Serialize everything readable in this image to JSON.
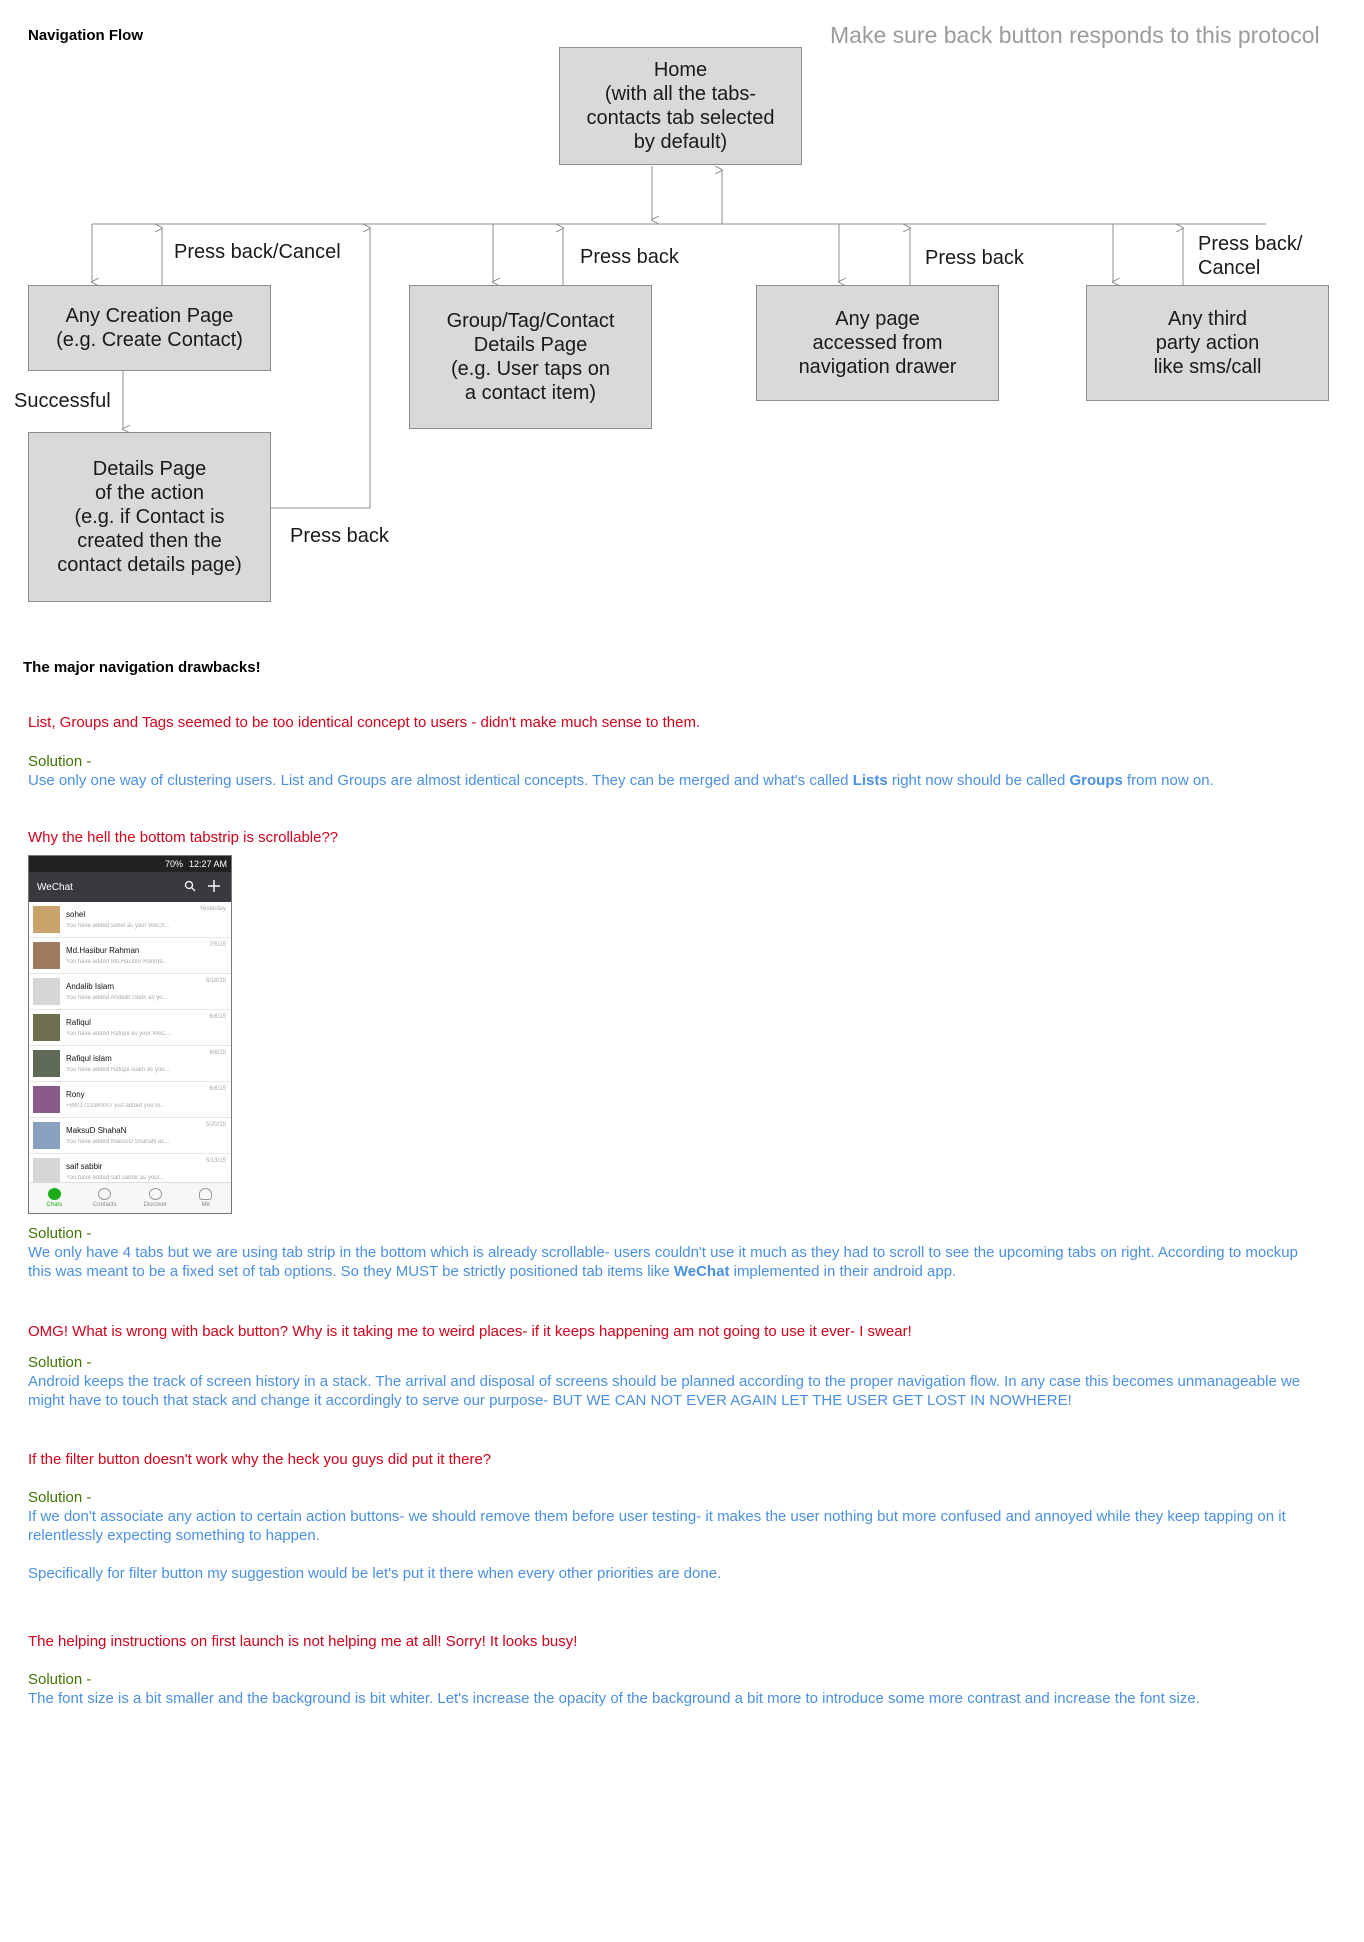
{
  "diagram": {
    "heading": "Navigation Flow",
    "note": "Make sure back button responds to this protocol",
    "boxes": {
      "home": "Home\n(with all the tabs-\ncontacts tab selected\nby default)",
      "creation": "Any Creation Page\n(e.g. Create Contact)",
      "details_action": "Details Page\nof the action\n(e.g. if Contact is\ncreated then the\ncontact details page)",
      "group_details": "Group/Tag/Contact\nDetails Page\n(e.g. User taps on\na contact item)",
      "drawer_page": "Any page\naccessed from\nnavigation drawer",
      "third_party": "Any third\nparty action\nlike sms/call"
    },
    "edge_labels": {
      "creation_back": "Press back/Cancel",
      "successful": "Successful",
      "details_back": "Press back",
      "group_back": "Press back",
      "drawer_back": "Press back",
      "third_back": "Press back/\nCancel"
    }
  },
  "notes": {
    "heading": "The major navigation drawbacks!",
    "issue1": "List, Groups and Tags seemed to be too identical concept to users - didn't make much sense to them.",
    "solution_label": "Solution -",
    "sol1": {
      "a": "Use only one way of clustering users. List and Groups are almost identical concepts. They can be merged and what's called ",
      "b": "Lists",
      "c": " right now should be called ",
      "d": "Groups",
      "e": " from now on."
    },
    "issue2": "Why the hell the bottom tabstrip is scrollable??",
    "sol2": {
      "a": "We only have 4 tabs but we are using tab strip in the bottom which is already scrollable- users couldn't use it much as they had to scroll to see the upcoming tabs on right. According to mockup this was meant to be a fixed set of tab options. So they MUST be strictly positioned tab items like ",
      "b": "WeChat",
      "c": " implemented in their android app."
    },
    "issue3": "OMG! What is wrong with back button? Why is it taking me to weird places- if it keeps happening am not going to use it ever- I swear!",
    "sol3": "Android keeps the track of screen history in a stack. The arrival and disposal of screens should be planned according to the proper navigation flow. In any case this becomes unmanageable we might have to touch that stack and change it accordingly to serve our purpose- BUT WE CAN NOT EVER AGAIN LET THE USER GET LOST IN NOWHERE!",
    "issue4": "If the filter button doesn't work why the heck you guys did put it there?",
    "sol4a": "If we don't associate any action to certain action buttons- we should remove them before user testing- it makes the user nothing but more confused and annoyed while they keep tapping on it relentlessly expecting something to happen.",
    "sol4b": "Specifically for  filter button my suggestion would be let's put it there when every other priorities are done.",
    "issue5": "The helping instructions on first launch is not helping me at all! Sorry! It looks busy!",
    "sol5": "The font size is a bit smaller and the background is bit whiter. Let's increase the opacity of the background a bit more to introduce some more contrast and increase the font size."
  },
  "phone": {
    "status_time": "12:27 AM",
    "status_batt": "70%",
    "app_title": "WeChat",
    "search_icon": "search-icon",
    "add_icon": "plus-icon",
    "chats": [
      {
        "name": "sohel",
        "msg": "You have added sohel as your WeCh...",
        "date": "Yesterday",
        "avatar": "#c8a36b"
      },
      {
        "name": "Md.Hasibur Rahman",
        "msg": "You have added Md.Hasibur Rahma...",
        "date": "7/5/15",
        "avatar": "#a07a5f"
      },
      {
        "name": "Andalib Islam",
        "msg": "You have added Andalib Islam as yo...",
        "date": "6/18/15",
        "avatar": "#d6d6d6"
      },
      {
        "name": "Rafiqul",
        "msg": "You have added Rafiqul as your WeC...",
        "date": "6/6/15",
        "avatar": "#6d6f4f"
      },
      {
        "name": "Rafiqul islam",
        "msg": "You have added Rafiqul islam as you...",
        "date": "6/6/15",
        "avatar": "#5e6a55"
      },
      {
        "name": "Rony",
        "msg": "+8801713380007 just added you to...",
        "date": "6/6/15",
        "avatar": "#8a5a8a"
      },
      {
        "name": "MaksuD ShahaN",
        "msg": "You have added MaksuD ShahaN as...",
        "date": "5/20/15",
        "avatar": "#8aa0c0"
      },
      {
        "name": "saif sabbir",
        "msg": "You have added saif sabbir as your...",
        "date": "5/13/15",
        "avatar": "#d6d6d6"
      }
    ],
    "tabs": [
      "Chats",
      "Contacts",
      "Discover",
      "Me"
    ],
    "active_color": "#1aad19"
  }
}
